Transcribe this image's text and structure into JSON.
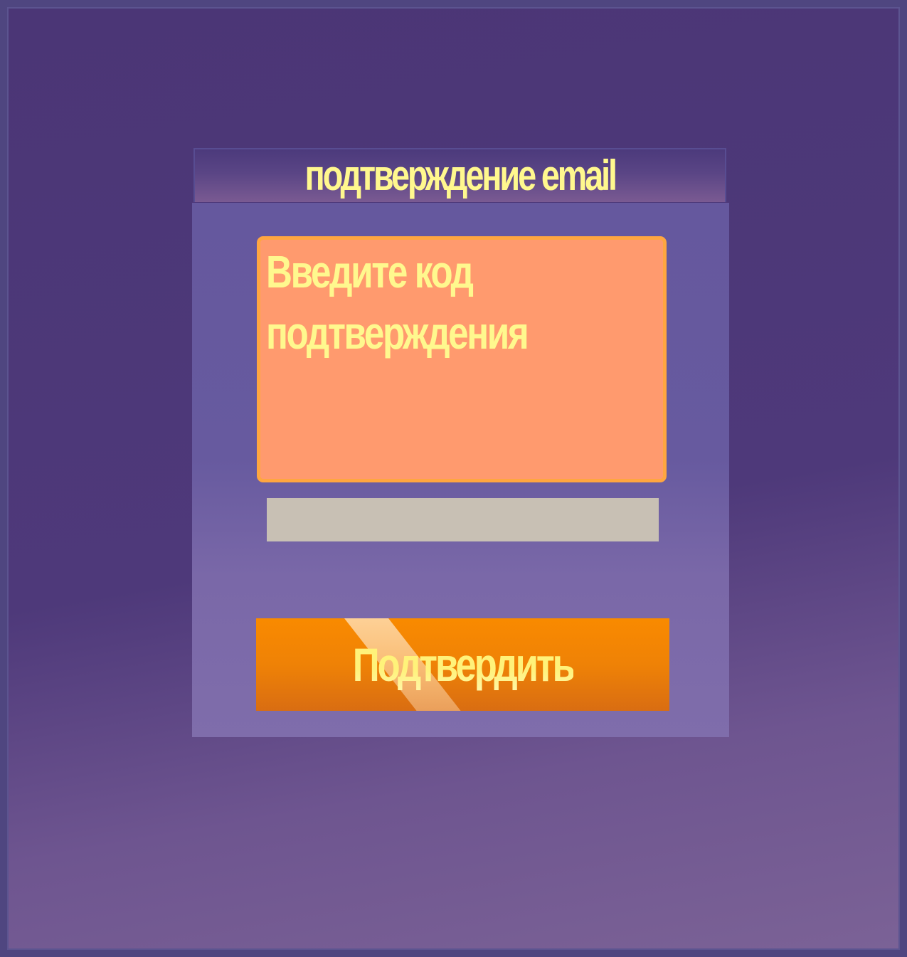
{
  "header": {
    "title": "подтверждение email"
  },
  "message": {
    "text": "Введите код подтверждения"
  },
  "code_input": {
    "value": "",
    "placeholder": ""
  },
  "confirm_button": {
    "label": "Подтвердить"
  },
  "colors": {
    "background": "#4b3676",
    "panel": "#65589e",
    "text_yellow": "#fff88e",
    "message_box": "#ff9a6e",
    "message_border": "#ffa640",
    "input": "#c8c0b4",
    "button": "#f98a00"
  }
}
